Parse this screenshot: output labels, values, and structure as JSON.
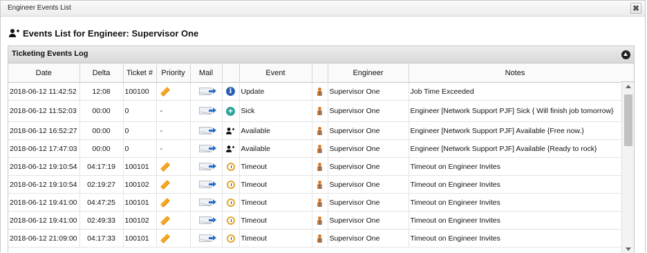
{
  "window": {
    "title": "Engineer Events List",
    "close_label": "✖"
  },
  "heading": "Events List for Engineer: Supervisor One",
  "panel": {
    "title": "Ticketing Events Log"
  },
  "columns": {
    "date": "Date",
    "delta": "Delta",
    "ticket": "Ticket #",
    "priority": "Priority",
    "mail": "Mail",
    "event_icon": "",
    "event": "Event",
    "engineer_icon": "",
    "engineer": "Engineer",
    "notes": "Notes"
  },
  "rows": [
    {
      "date": "2018-06-12 11:42:52",
      "delta": "12:08",
      "ticket": "100100",
      "priority": "pencil-icon",
      "priority_text": "",
      "event_icon": "info-icon",
      "event": "Update",
      "engineer": "Supervisor One",
      "notes": "Job Time Exceeded"
    },
    {
      "date": "2018-06-12 11:52:03",
      "delta": "00:00",
      "ticket": "0",
      "priority": "",
      "priority_text": "-",
      "event_icon": "plus-circle-icon",
      "event": "Sick",
      "engineer": "Supervisor One",
      "notes": "Engineer [Network Support PJF] Sick { Will finish job tomorrow}"
    },
    {
      "date": "2018-06-12 16:52:27",
      "delta": "00:00",
      "ticket": "0",
      "priority": "",
      "priority_text": "-",
      "event_icon": "user-add-icon",
      "event": "Available",
      "engineer": "Supervisor One",
      "notes": "Engineer [Network Support PJF] Available {Free now.}"
    },
    {
      "date": "2018-06-12 17:47:03",
      "delta": "00:00",
      "ticket": "0",
      "priority": "",
      "priority_text": "-",
      "event_icon": "user-add-icon",
      "event": "Available",
      "engineer": "Supervisor One",
      "notes": "Engineer [Network Support PJF] Available {Ready to rock}"
    },
    {
      "date": "2018-06-12 19:10:54",
      "delta": "04:17:19",
      "ticket": "100101",
      "priority": "pencil-icon",
      "priority_text": "",
      "event_icon": "clock-icon",
      "event": "Timeout",
      "engineer": "Supervisor One",
      "notes": "Timeout on Engineer Invites"
    },
    {
      "date": "2018-06-12 19:10:54",
      "delta": "02:19:27",
      "ticket": "100102",
      "priority": "pencil-icon",
      "priority_text": "",
      "event_icon": "clock-icon",
      "event": "Timeout",
      "engineer": "Supervisor One",
      "notes": "Timeout on Engineer Invites"
    },
    {
      "date": "2018-06-12 19:41:00",
      "delta": "04:47:25",
      "ticket": "100101",
      "priority": "pencil-icon",
      "priority_text": "",
      "event_icon": "clock-icon",
      "event": "Timeout",
      "engineer": "Supervisor One",
      "notes": "Timeout on Engineer Invites"
    },
    {
      "date": "2018-06-12 19:41:00",
      "delta": "02:49:33",
      "ticket": "100102",
      "priority": "pencil-icon",
      "priority_text": "",
      "event_icon": "clock-icon",
      "event": "Timeout",
      "engineer": "Supervisor One",
      "notes": "Timeout on Engineer Invites"
    },
    {
      "date": "2018-06-12 21:09:00",
      "delta": "04:17:33",
      "ticket": "100101",
      "priority": "pencil-icon",
      "priority_text": "",
      "event_icon": "clock-icon",
      "event": "Timeout",
      "engineer": "Supervisor One",
      "notes": "Timeout on Engineer Invites"
    }
  ]
}
